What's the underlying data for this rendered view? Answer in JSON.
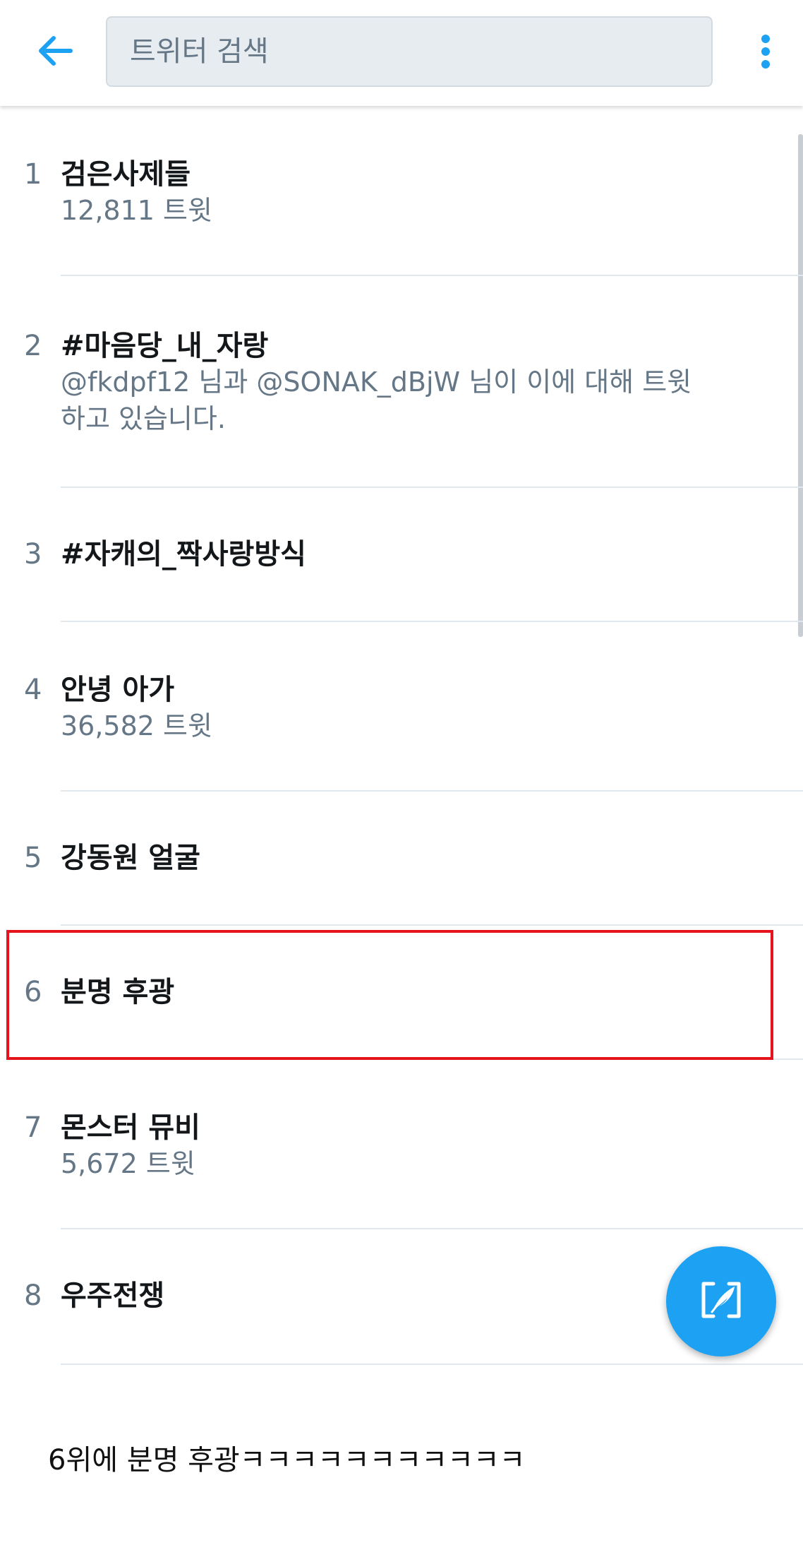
{
  "header": {
    "back_icon": "arrow-left-icon",
    "search_placeholder": "트위터 검색",
    "menu_icon": "more-vertical-icon",
    "accent_color": "#1da1f2"
  },
  "trends": [
    {
      "rank": "1",
      "title": "검은사제들",
      "subtitle": "12,811 트윗"
    },
    {
      "rank": "2",
      "title": "#마음당_내_자랑",
      "subtitle": "@fkdpf12 님과 @SONAK_dBjW 님이 이에 대해 트윗하고 있습니다."
    },
    {
      "rank": "3",
      "title": "#자캐의_짝사랑방식",
      "subtitle": ""
    },
    {
      "rank": "4",
      "title": "안녕 아가",
      "subtitle": "36,582 트윗"
    },
    {
      "rank": "5",
      "title": "강동원 얼굴",
      "subtitle": ""
    },
    {
      "rank": "6",
      "title": "분명 후광",
      "subtitle": ""
    },
    {
      "rank": "7",
      "title": "몬스터 뮤비",
      "subtitle": "5,672 트윗"
    },
    {
      "rank": "8",
      "title": "우주전쟁",
      "subtitle": ""
    }
  ],
  "highlight": {
    "color": "#e5141c",
    "trend_rank": "6"
  },
  "fab": {
    "icon": "compose-tweet-icon",
    "color": "#1da1f2"
  },
  "caption": "6위에 분명 후광ㅋㅋㅋㅋㅋㅋㅋㅋㅋㅋㅋ"
}
